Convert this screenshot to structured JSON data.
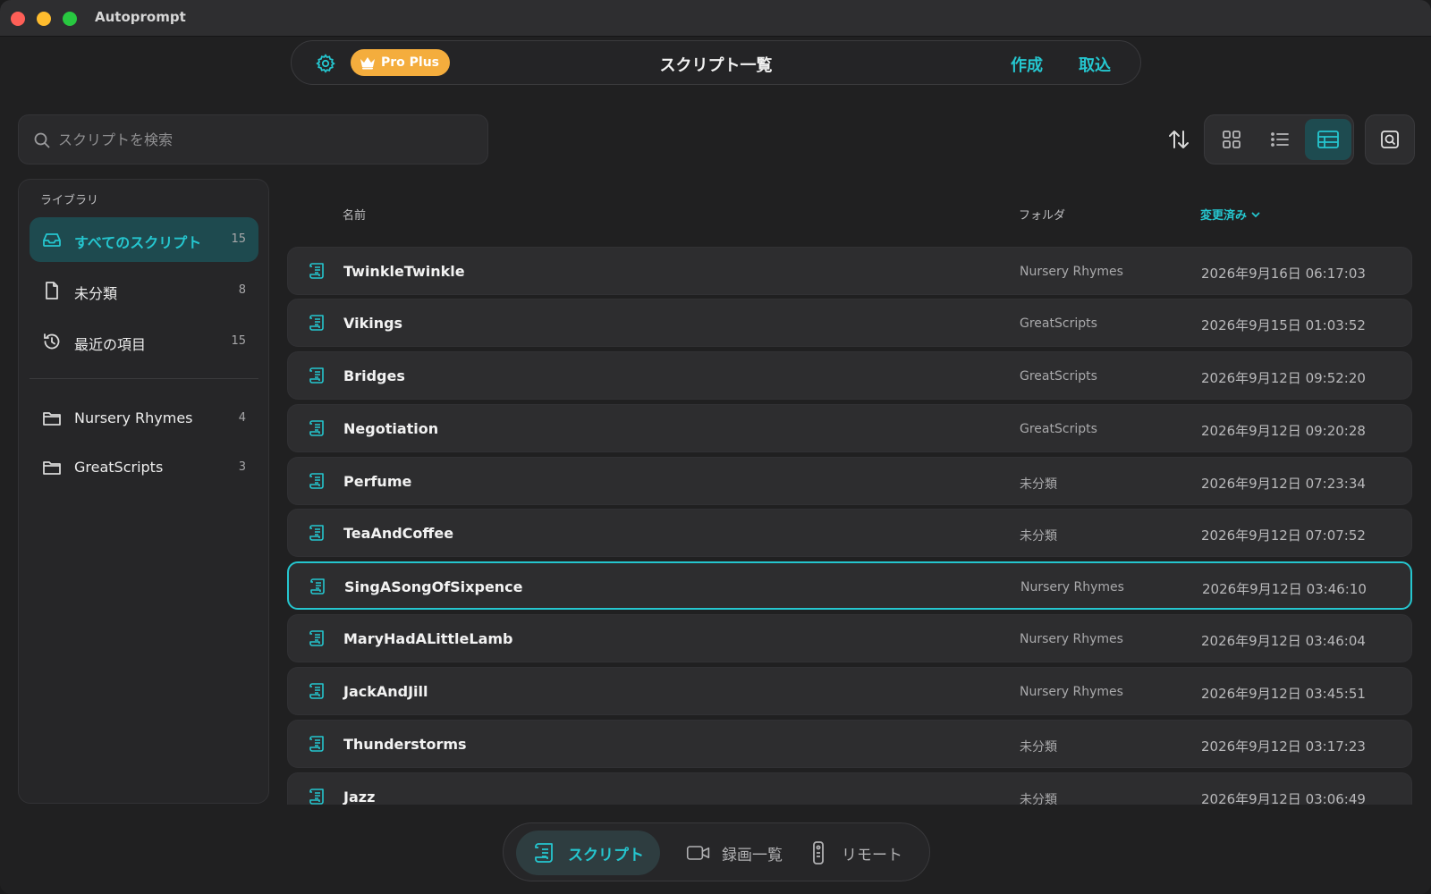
{
  "window": {
    "title": "Autoprompt"
  },
  "topbar": {
    "badge": "Pro Plus",
    "title": "スクリプト一覧",
    "create_label": "作成",
    "import_label": "取込"
  },
  "search": {
    "placeholder": "スクリプトを検索"
  },
  "sidebar": {
    "heading": "ライブラリ",
    "items": [
      {
        "label": "すべてのスクリプト",
        "count": "15",
        "icon": "inbox-icon",
        "active": true
      },
      {
        "label": "未分類",
        "count": "8",
        "icon": "document-icon"
      },
      {
        "label": "最近の項目",
        "count": "15",
        "icon": "history-icon"
      }
    ],
    "folders": [
      {
        "label": "Nursery Rhymes",
        "count": "4",
        "icon": "folder-icon"
      },
      {
        "label": "GreatScripts",
        "count": "3",
        "icon": "folder-icon"
      }
    ]
  },
  "table": {
    "columns": {
      "name": "名前",
      "folder": "フォルダ",
      "modified": "変更済み"
    },
    "rows": [
      {
        "name": "TwinkleTwinkle",
        "folder": "Nursery Rhymes",
        "date": "2026年9月16日 06:17:03"
      },
      {
        "name": "Vikings",
        "folder": "GreatScripts",
        "date": "2026年9月15日 01:03:52"
      },
      {
        "name": "Bridges",
        "folder": "GreatScripts",
        "date": "2026年9月12日 09:52:20"
      },
      {
        "name": "Negotiation",
        "folder": "GreatScripts",
        "date": "2026年9月12日 09:20:28"
      },
      {
        "name": "Perfume",
        "folder": "未分類",
        "date": "2026年9月12日 07:23:34"
      },
      {
        "name": "TeaAndCoffee",
        "folder": "未分類",
        "date": "2026年9月12日 07:07:52"
      },
      {
        "name": "SingASongOfSixpence",
        "folder": "Nursery Rhymes",
        "date": "2026年9月12日 03:46:10",
        "selected": true
      },
      {
        "name": "MaryHadALittleLamb",
        "folder": "Nursery Rhymes",
        "date": "2026年9月12日 03:46:04"
      },
      {
        "name": "JackAndJill",
        "folder": "Nursery Rhymes",
        "date": "2026年9月12日 03:45:51"
      },
      {
        "name": "Thunderstorms",
        "folder": "未分類",
        "date": "2026年9月12日 03:17:23"
      },
      {
        "name": "Jazz",
        "folder": "未分類",
        "date": "2026年9月12日 03:06:49"
      }
    ]
  },
  "bottom_nav": {
    "scripts_label": "スクリプト",
    "recordings_label": "録画一覧",
    "remote_label": "リモート"
  },
  "colors": {
    "accent": "#25c6cf",
    "badge": "#f4ad3d",
    "background": "#202021"
  }
}
